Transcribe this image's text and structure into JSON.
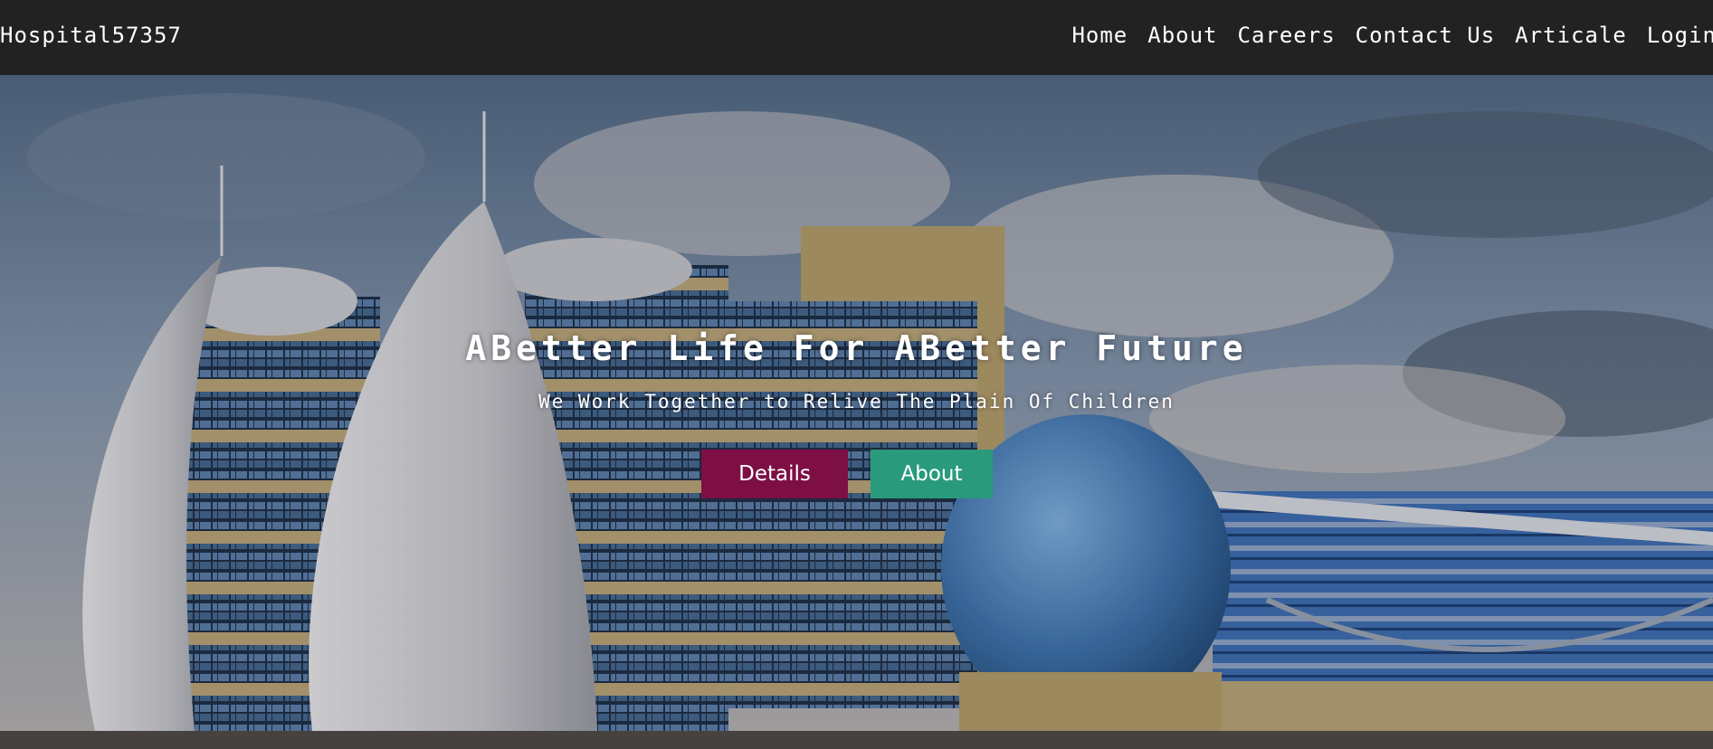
{
  "navbar": {
    "brand": "Hospital57357",
    "links": [
      {
        "label": "Home"
      },
      {
        "label": "About"
      },
      {
        "label": "Careers"
      },
      {
        "label": "Contact Us"
      },
      {
        "label": "Articale"
      },
      {
        "label": "Login"
      }
    ]
  },
  "hero": {
    "title": "ABetter Life For ABetter Future",
    "subtitle": "We Work Together to Relive The Plain Of Children",
    "buttons": {
      "details": "Details",
      "about": "About"
    }
  },
  "colors": {
    "navbar_bg": "#222222",
    "details_button": "#7d0f45",
    "about_button": "#2a9a7d",
    "text": "#ffffff"
  }
}
